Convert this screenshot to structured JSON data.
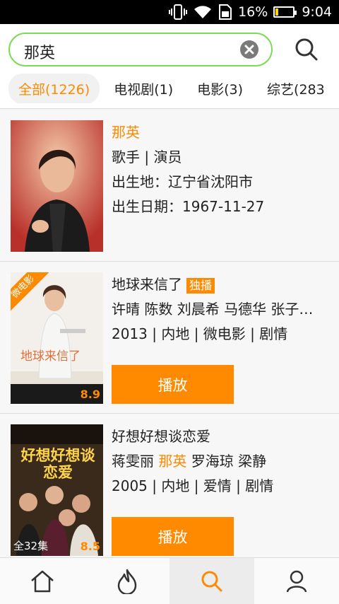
{
  "status_bar": {
    "battery": "16%",
    "time": "9:04",
    "battery_level": 0.16
  },
  "search": {
    "query": "那英"
  },
  "tabs": [
    {
      "label": "全部(1226)"
    },
    {
      "label": "电视剧(1)"
    },
    {
      "label": "电影(3)"
    },
    {
      "label": "综艺(283"
    }
  ],
  "results": [
    {
      "name": "那英",
      "role": "歌手 | 演员",
      "birthplace": "出生地：辽宁省沈阳市",
      "birthday": "出生日期：1967-11-27"
    },
    {
      "title": "地球来信了",
      "badge": "独播",
      "cast": "许晴 陈数 刘晨希 马德华 张子…",
      "meta": "2013 | 内地 | 微电影 | 剧情",
      "corner": "微电影",
      "rating": "8.9",
      "poster_text": "地球来信了",
      "play_label": "播放"
    },
    {
      "title": "好想好想谈恋爱",
      "cast_before": "蒋雯丽 ",
      "cast_highlight": "那英",
      "cast_after": " 罗海琼 梁静",
      "meta": "2005 | 内地 | 爱情 | 剧情",
      "episodes": "全32集",
      "rating": "8.5",
      "poster_text": "好想好想谈恋爱",
      "play_label": "播放"
    }
  ],
  "colors": {
    "accent": "#ff8a00",
    "search_border": "#7ed957"
  }
}
